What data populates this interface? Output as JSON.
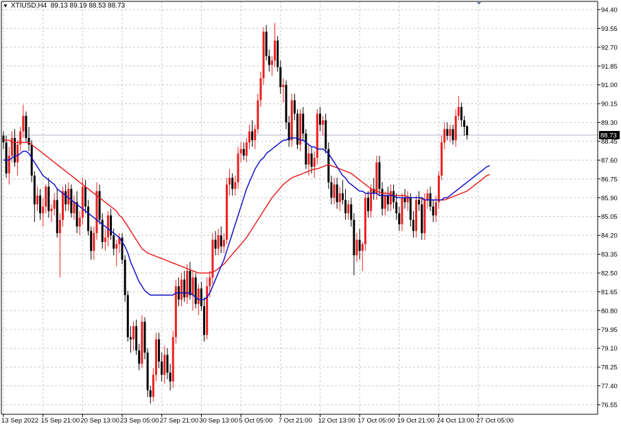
{
  "legend": {
    "symbol": "XTIUSD,H4",
    "ohlc": "89.13 89.19 88.53 88.73"
  },
  "colors": {
    "bull": "#e82020",
    "bear": "#000000",
    "ma_fast": "#1010c8",
    "ma_slow": "#e82020",
    "grid": "#c8c8c8",
    "current_price_line": "#b4b4c8",
    "current_price_tag_bg": "#000000",
    "current_price_tag_fg": "#ffffff"
  },
  "chart_data": {
    "type": "candlestick",
    "instrument": "XTIUSD",
    "timeframe": "H4",
    "y_ticks": [
      94.4,
      93.55,
      92.7,
      91.85,
      91.0,
      90.15,
      89.3,
      88.45,
      87.6,
      86.75,
      85.9,
      85.05,
      84.2,
      83.35,
      82.5,
      81.65,
      80.8,
      79.95,
      79.1,
      78.25,
      77.4,
      76.55
    ],
    "y_tick_labels": [
      "94.40",
      "93.55",
      "92.70",
      "91.85",
      "91.00",
      "90.15",
      "89.30",
      "88.45",
      "87.60",
      "86.75",
      "85.90",
      "85.05",
      "84.20",
      "83.35",
      "82.50",
      "81.65",
      "80.80",
      "79.95",
      "79.10",
      "78.25",
      "77.40",
      "76.55"
    ],
    "ylim": [
      76.3,
      94.6
    ],
    "current_price": 88.73,
    "current_price_label": "88.73",
    "x_tick_labels": [
      "13 Sep 2022",
      "15 Sep 21:00",
      "20 Sep 13:00",
      "23 Sep 05:00",
      "27 Sep 21:00",
      "30 Sep 13:00",
      "5 Oct 05:00",
      "7 Oct 21:00",
      "12 Oct 13:00",
      "17 Oct 05:00",
      "19 Oct 21:00",
      "24 Oct 13:00",
      "27 Oct 05:00"
    ],
    "x_tick_bar_index": [
      0,
      14,
      28,
      42,
      56,
      70,
      84,
      98,
      112,
      126,
      140,
      154,
      168
    ],
    "ohlc": [
      [
        88.7,
        88.9,
        88.1,
        88.4
      ],
      [
        88.4,
        88.7,
        86.8,
        87.0
      ],
      [
        87.0,
        88.2,
        86.5,
        87.8
      ],
      [
        87.8,
        88.9,
        87.5,
        88.6
      ],
      [
        88.6,
        89.0,
        87.3,
        87.5
      ],
      [
        87.5,
        88.5,
        86.9,
        88.3
      ],
      [
        88.3,
        89.1,
        88.0,
        88.9
      ],
      [
        88.9,
        90.1,
        88.6,
        89.6
      ],
      [
        89.6,
        89.8,
        88.4,
        88.6
      ],
      [
        88.6,
        89.1,
        88.0,
        88.3
      ],
      [
        88.3,
        88.5,
        86.6,
        86.9
      ],
      [
        86.9,
        87.1,
        84.8,
        85.6
      ],
      [
        85.6,
        86.4,
        85.3,
        86.0
      ],
      [
        86.0,
        86.3,
        84.9,
        85.2
      ],
      [
        85.2,
        85.9,
        84.6,
        85.5
      ],
      [
        85.5,
        86.5,
        85.2,
        86.4
      ],
      [
        86.4,
        86.8,
        85.0,
        85.3
      ],
      [
        85.3,
        85.6,
        84.8,
        85.4
      ],
      [
        85.4,
        86.1,
        85.1,
        85.8
      ],
      [
        85.8,
        86.3,
        84.1,
        84.3
      ],
      [
        84.3,
        85.2,
        82.3,
        84.9
      ],
      [
        84.9,
        86.4,
        84.6,
        86.2
      ],
      [
        86.2,
        86.5,
        85.3,
        85.6
      ],
      [
        85.6,
        86.6,
        85.3,
        86.3
      ],
      [
        86.3,
        86.5,
        85.0,
        85.2
      ],
      [
        85.2,
        86.0,
        84.9,
        85.7
      ],
      [
        85.7,
        86.2,
        84.3,
        84.6
      ],
      [
        84.6,
        85.3,
        84.2,
        85.0
      ],
      [
        85.0,
        86.8,
        84.7,
        86.4
      ],
      [
        86.4,
        86.7,
        85.2,
        85.5
      ],
      [
        85.5,
        85.8,
        84.2,
        84.4
      ],
      [
        84.4,
        84.6,
        83.1,
        83.5
      ],
      [
        83.5,
        84.6,
        83.1,
        84.3
      ],
      [
        84.3,
        86.6,
        84.0,
        86.2
      ],
      [
        86.2,
        86.5,
        84.7,
        84.9
      ],
      [
        84.9,
        85.2,
        83.6,
        83.9
      ],
      [
        83.9,
        84.5,
        83.5,
        84.1
      ],
      [
        84.1,
        85.3,
        83.7,
        85.1
      ],
      [
        85.1,
        85.4,
        84.0,
        84.2
      ],
      [
        84.2,
        84.5,
        83.3,
        83.6
      ],
      [
        83.6,
        84.0,
        82.8,
        83.8
      ],
      [
        83.8,
        84.3,
        83.4,
        84.1
      ],
      [
        84.1,
        84.3,
        82.9,
        83.1
      ],
      [
        83.1,
        83.3,
        81.2,
        81.5
      ],
      [
        81.5,
        81.7,
        79.4,
        79.6
      ],
      [
        79.6,
        80.1,
        78.9,
        79.5
      ],
      [
        79.5,
        80.3,
        79.0,
        80.1
      ],
      [
        80.1,
        80.4,
        78.8,
        79.0
      ],
      [
        79.0,
        79.3,
        78.1,
        78.4
      ],
      [
        78.4,
        80.6,
        78.2,
        80.3
      ],
      [
        80.3,
        80.5,
        78.6,
        78.9
      ],
      [
        78.9,
        79.1,
        76.9,
        77.2
      ],
      [
        77.2,
        77.4,
        76.6,
        76.9
      ],
      [
        76.9,
        78.2,
        76.7,
        77.9
      ],
      [
        77.9,
        79.8,
        77.6,
        79.5
      ],
      [
        79.5,
        79.8,
        78.2,
        78.5
      ],
      [
        78.5,
        78.9,
        77.6,
        77.9
      ],
      [
        77.9,
        79.2,
        77.5,
        78.8
      ],
      [
        78.8,
        79.1,
        77.7,
        78.0
      ],
      [
        78.0,
        78.4,
        77.2,
        77.6
      ],
      [
        77.6,
        79.9,
        77.3,
        79.6
      ],
      [
        79.6,
        82.2,
        79.3,
        81.9
      ],
      [
        81.9,
        82.3,
        81.0,
        81.3
      ],
      [
        81.3,
        82.5,
        81.0,
        82.2
      ],
      [
        82.2,
        82.6,
        81.2,
        81.4
      ],
      [
        81.4,
        82.9,
        81.1,
        82.6
      ],
      [
        82.6,
        83.0,
        81.3,
        81.5
      ],
      [
        81.5,
        82.6,
        80.8,
        82.3
      ],
      [
        82.3,
        82.5,
        80.9,
        81.1
      ],
      [
        81.1,
        82.0,
        80.6,
        81.8
      ],
      [
        81.8,
        82.1,
        80.8,
        81.0
      ],
      [
        81.0,
        81.4,
        79.4,
        79.7
      ],
      [
        79.7,
        82.3,
        79.5,
        81.9
      ],
      [
        81.9,
        82.6,
        81.4,
        82.3
      ],
      [
        82.3,
        84.3,
        82.0,
        84.0
      ],
      [
        84.0,
        84.4,
        83.3,
        83.6
      ],
      [
        83.6,
        84.5,
        83.3,
        84.2
      ],
      [
        84.2,
        84.6,
        83.4,
        83.7
      ],
      [
        83.7,
        84.3,
        83.4,
        84.0
      ],
      [
        84.0,
        86.8,
        83.8,
        86.5
      ],
      [
        86.5,
        87.2,
        86.0,
        86.8
      ],
      [
        86.8,
        87.0,
        86.0,
        86.3
      ],
      [
        86.3,
        86.9,
        86.0,
        86.6
      ],
      [
        86.6,
        88.2,
        86.3,
        87.9
      ],
      [
        87.9,
        88.4,
        87.5,
        88.1
      ],
      [
        88.1,
        88.4,
        87.6,
        87.8
      ],
      [
        87.8,
        88.6,
        87.5,
        88.4
      ],
      [
        88.4,
        89.2,
        88.1,
        88.9
      ],
      [
        88.9,
        89.4,
        88.2,
        88.5
      ],
      [
        88.5,
        89.2,
        88.1,
        89.0
      ],
      [
        89.0,
        90.6,
        88.8,
        90.3
      ],
      [
        90.3,
        91.6,
        90.0,
        91.3
      ],
      [
        91.3,
        93.6,
        91.0,
        93.4
      ],
      [
        93.4,
        93.7,
        92.1,
        92.3
      ],
      [
        92.3,
        92.6,
        91.6,
        91.9
      ],
      [
        91.9,
        92.3,
        91.4,
        92.1
      ],
      [
        92.1,
        93.8,
        91.8,
        93.0
      ],
      [
        93.0,
        93.2,
        91.6,
        91.8
      ],
      [
        91.8,
        92.1,
        90.6,
        90.9
      ],
      [
        90.9,
        91.3,
        90.2,
        91.0
      ],
      [
        91.0,
        91.2,
        89.0,
        89.3
      ],
      [
        89.3,
        89.6,
        88.2,
        88.5
      ],
      [
        88.5,
        90.6,
        88.2,
        90.3
      ],
      [
        90.3,
        90.6,
        89.4,
        89.7
      ],
      [
        89.7,
        89.9,
        88.1,
        88.3
      ],
      [
        88.3,
        89.9,
        88.0,
        89.7
      ],
      [
        89.7,
        90.0,
        88.5,
        88.8
      ],
      [
        88.8,
        89.0,
        87.2,
        87.4
      ],
      [
        87.4,
        88.3,
        86.9,
        87.9
      ],
      [
        87.9,
        88.2,
        87.0,
        87.3
      ],
      [
        87.3,
        88.0,
        86.8,
        87.7
      ],
      [
        87.7,
        89.9,
        87.4,
        89.7
      ],
      [
        89.7,
        90.0,
        88.9,
        89.2
      ],
      [
        89.2,
        89.6,
        88.7,
        89.4
      ],
      [
        89.4,
        89.7,
        87.9,
        88.1
      ],
      [
        88.1,
        88.4,
        86.3,
        86.6
      ],
      [
        86.6,
        86.9,
        85.6,
        85.9
      ],
      [
        85.9,
        86.8,
        85.6,
        86.5
      ],
      [
        86.5,
        86.8,
        85.4,
        85.7
      ],
      [
        85.7,
        86.4,
        85.3,
        86.1
      ],
      [
        86.1,
        86.7,
        85.6,
        85.8
      ],
      [
        85.8,
        86.3,
        84.9,
        85.2
      ],
      [
        85.2,
        85.8,
        84.9,
        85.6
      ],
      [
        85.6,
        85.9,
        84.6,
        84.9
      ],
      [
        84.9,
        85.2,
        82.4,
        83.3
      ],
      [
        83.3,
        84.3,
        83.0,
        84.0
      ],
      [
        84.0,
        84.5,
        83.1,
        83.5
      ],
      [
        83.5,
        83.9,
        82.6,
        83.8
      ],
      [
        83.8,
        86.1,
        83.5,
        85.9
      ],
      [
        85.9,
        86.2,
        85.0,
        85.3
      ],
      [
        85.3,
        86.5,
        85.0,
        86.3
      ],
      [
        86.3,
        86.8,
        85.8,
        86.1
      ],
      [
        86.1,
        87.8,
        85.8,
        87.5
      ],
      [
        87.5,
        87.8,
        86.0,
        86.3
      ],
      [
        86.3,
        86.6,
        85.1,
        85.4
      ],
      [
        85.4,
        86.2,
        85.1,
        86.0
      ],
      [
        86.0,
        86.4,
        85.3,
        85.6
      ],
      [
        85.6,
        86.5,
        85.3,
        86.2
      ],
      [
        86.2,
        86.5,
        85.4,
        85.7
      ],
      [
        85.7,
        86.1,
        84.9,
        85.2
      ],
      [
        85.2,
        85.5,
        84.4,
        84.7
      ],
      [
        84.7,
        86.1,
        84.4,
        85.9
      ],
      [
        85.9,
        86.3,
        85.4,
        85.7
      ],
      [
        85.7,
        86.2,
        85.3,
        85.9
      ],
      [
        85.9,
        86.1,
        84.6,
        84.9
      ],
      [
        84.9,
        85.3,
        84.1,
        84.4
      ],
      [
        84.4,
        86.0,
        84.1,
        85.8
      ],
      [
        85.8,
        86.2,
        85.3,
        85.6
      ],
      [
        85.6,
        85.9,
        84.0,
        84.3
      ],
      [
        84.3,
        86.1,
        84.0,
        85.8
      ],
      [
        85.8,
        86.3,
        85.4,
        86.1
      ],
      [
        86.1,
        86.4,
        85.3,
        85.5
      ],
      [
        85.5,
        85.8,
        84.8,
        85.1
      ],
      [
        85.1,
        86.0,
        84.8,
        85.7
      ],
      [
        85.7,
        87.1,
        85.4,
        86.9
      ],
      [
        86.9,
        88.7,
        86.7,
        88.4
      ],
      [
        88.4,
        89.3,
        88.1,
        89.0
      ],
      [
        89.0,
        89.3,
        88.5,
        88.7
      ],
      [
        88.7,
        89.2,
        88.4,
        89.0
      ],
      [
        89.0,
        89.2,
        88.3,
        88.5
      ],
      [
        88.5,
        89.9,
        88.2,
        89.6
      ],
      [
        89.6,
        90.5,
        89.4,
        90.0
      ],
      [
        90.0,
        90.2,
        89.1,
        89.4
      ],
      [
        89.4,
        89.6,
        88.7,
        89.1
      ],
      [
        89.13,
        89.19,
        88.53,
        88.73
      ]
    ],
    "ma_fast": [
      87.6,
      87.6,
      87.6,
      87.7,
      87.8,
      87.8,
      87.9,
      88.0,
      88.0,
      87.9,
      87.7,
      87.5,
      87.3,
      87.1,
      86.9,
      86.8,
      86.7,
      86.6,
      86.5,
      86.3,
      86.2,
      86.1,
      86.0,
      85.9,
      85.8,
      85.7,
      85.6,
      85.5,
      85.4,
      85.3,
      85.2,
      85.1,
      85.0,
      84.9,
      84.8,
      84.7,
      84.6,
      84.5,
      84.4,
      84.3,
      84.2,
      84.1,
      83.9,
      83.7,
      83.4,
      83.0,
      82.7,
      82.4,
      82.1,
      81.9,
      81.7,
      81.6,
      81.5,
      81.5,
      81.5,
      81.5,
      81.5,
      81.5,
      81.5,
      81.5,
      81.5,
      81.6,
      81.6,
      81.6,
      81.6,
      81.6,
      81.6,
      81.5,
      81.4,
      81.3,
      81.3,
      81.3,
      81.4,
      81.6,
      81.9,
      82.2,
      82.5,
      82.8,
      83.1,
      83.5,
      83.9,
      84.3,
      84.7,
      85.1,
      85.5,
      85.9,
      86.3,
      86.6,
      86.9,
      87.2,
      87.4,
      87.6,
      87.7,
      87.9,
      88.0,
      88.1,
      88.2,
      88.3,
      88.4,
      88.5,
      88.5,
      88.6,
      88.6,
      88.6,
      88.6,
      88.5,
      88.5,
      88.4,
      88.3,
      88.2,
      88.2,
      88.1,
      88.1,
      88.1,
      88.0,
      87.9,
      87.7,
      87.5,
      87.3,
      87.1,
      86.9,
      86.8,
      86.6,
      86.5,
      86.4,
      86.3,
      86.2,
      86.2,
      86.1,
      86.1,
      86.1,
      86.1,
      86.1,
      86.0,
      86.0,
      86.0,
      86.0,
      86.0,
      86.0,
      85.9,
      85.9,
      85.9,
      85.9,
      85.9,
      85.9,
      85.9,
      85.9,
      85.9,
      85.9,
      85.8,
      85.8,
      85.8,
      85.8,
      85.8,
      85.8,
      85.8,
      85.9,
      85.9,
      86.0,
      86.1,
      86.2,
      86.3,
      86.4,
      86.5,
      86.6,
      86.7,
      86.8,
      86.9,
      87.0,
      87.1,
      87.2,
      87.3,
      87.35
    ],
    "ma_slow": [
      88.5,
      88.5,
      88.5,
      88.4,
      88.4,
      88.4,
      88.4,
      88.4,
      88.4,
      88.4,
      88.3,
      88.2,
      88.1,
      88.0,
      87.9,
      87.8,
      87.7,
      87.6,
      87.5,
      87.4,
      87.3,
      87.2,
      87.1,
      87.0,
      86.9,
      86.8,
      86.7,
      86.6,
      86.5,
      86.4,
      86.3,
      86.2,
      86.1,
      86.0,
      85.9,
      85.8,
      85.7,
      85.6,
      85.5,
      85.4,
      85.3,
      85.1,
      85.0,
      84.8,
      84.6,
      84.4,
      84.2,
      84.0,
      83.8,
      83.6,
      83.5,
      83.4,
      83.35,
      83.3,
      83.25,
      83.2,
      83.15,
      83.1,
      83.05,
      83.0,
      82.95,
      82.9,
      82.85,
      82.8,
      82.75,
      82.7,
      82.65,
      82.6,
      82.55,
      82.5,
      82.5,
      82.5,
      82.5,
      82.5,
      82.55,
      82.6,
      82.7,
      82.8,
      82.9,
      83.05,
      83.2,
      83.35,
      83.5,
      83.65,
      83.8,
      83.95,
      84.1,
      84.3,
      84.5,
      84.7,
      84.9,
      85.1,
      85.3,
      85.5,
      85.7,
      85.9,
      86.05,
      86.2,
      86.35,
      86.5,
      86.6,
      86.7,
      86.8,
      86.85,
      86.9,
      86.95,
      87.0,
      87.05,
      87.1,
      87.15,
      87.2,
      87.2,
      87.25,
      87.3,
      87.35,
      87.4,
      87.35,
      87.3,
      87.25,
      87.2,
      87.15,
      87.1,
      87.05,
      87.0,
      86.9,
      86.8,
      86.7,
      86.6,
      86.5,
      86.4,
      86.3,
      86.25,
      86.2,
      86.15,
      86.1,
      86.1,
      86.1,
      86.05,
      86.0,
      86.0,
      86.0,
      86.0,
      86.0,
      85.95,
      85.9,
      85.9,
      85.9,
      85.9,
      85.85,
      85.8,
      85.8,
      85.8,
      85.8,
      85.8,
      85.8,
      85.8,
      85.8,
      85.85,
      85.9,
      85.95,
      86.0,
      86.05,
      86.1,
      86.15,
      86.2,
      86.3,
      86.4,
      86.5,
      86.6,
      86.7,
      86.8,
      86.9,
      86.95
    ]
  }
}
